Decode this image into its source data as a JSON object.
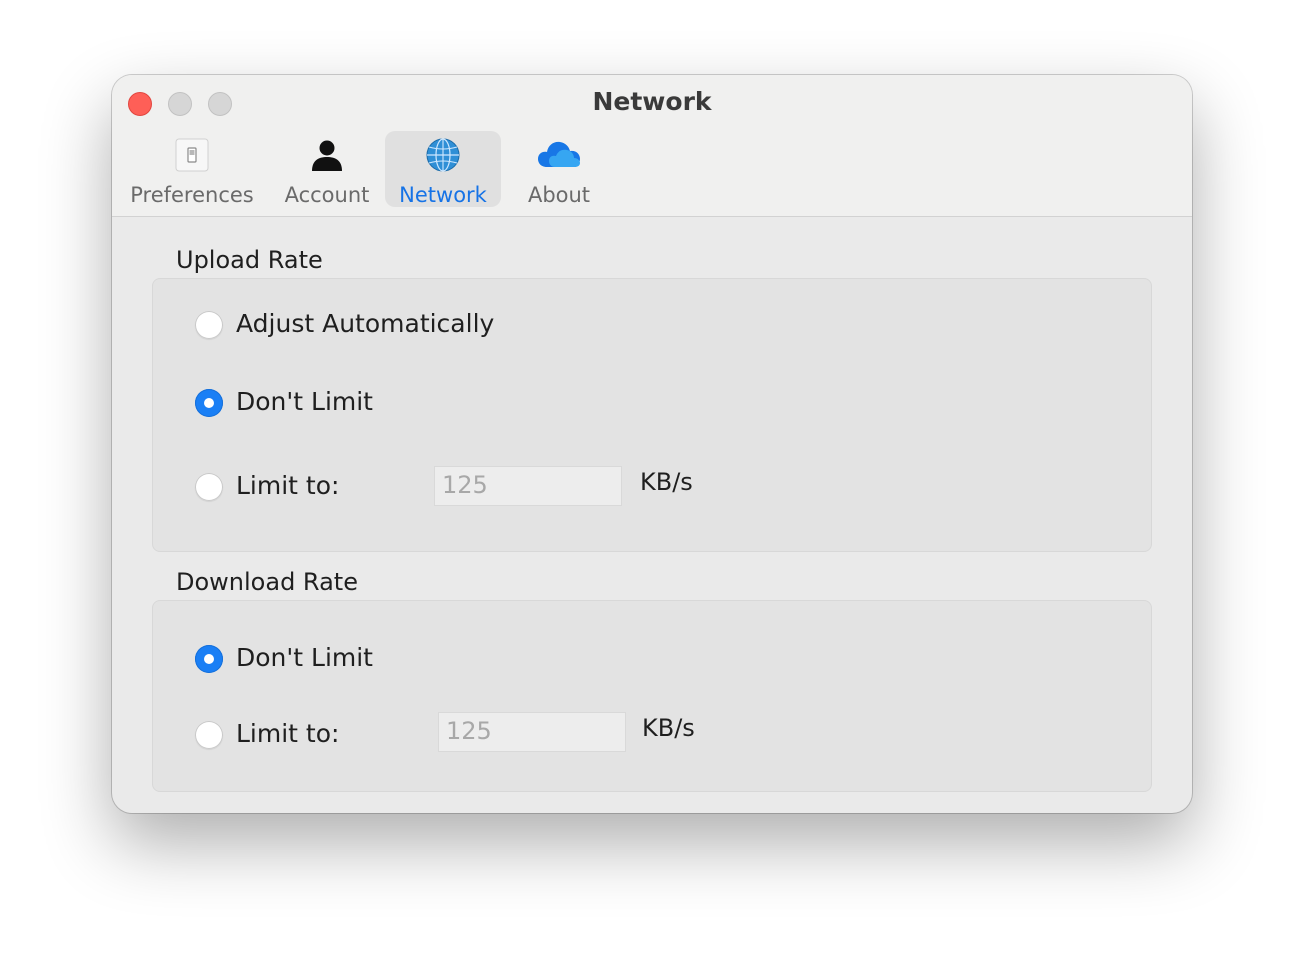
{
  "window": {
    "title": "Network"
  },
  "toolbar": {
    "tabs": [
      {
        "label": "Preferences",
        "icon": "switch-icon",
        "active": false
      },
      {
        "label": "Account",
        "icon": "person-icon",
        "active": false
      },
      {
        "label": "Network",
        "icon": "globe-icon",
        "active": true
      },
      {
        "label": "About",
        "icon": "cloud-icon",
        "active": false
      }
    ]
  },
  "upload": {
    "title": "Upload Rate",
    "options": [
      {
        "label": "Adjust Automatically",
        "checked": false
      },
      {
        "label": "Don't Limit",
        "checked": true
      },
      {
        "label": "Limit to:",
        "checked": false
      }
    ],
    "limit_value": "125",
    "unit": "KB/s"
  },
  "download": {
    "title": "Download Rate",
    "options": [
      {
        "label": "Don't Limit",
        "checked": true
      },
      {
        "label": "Limit to:",
        "checked": false
      }
    ],
    "limit_value": "125",
    "unit": "KB/s"
  },
  "colors": {
    "accent": "#1a7ff5",
    "close_button": "#fe5f57",
    "active_tab_text": "#1673e6"
  }
}
